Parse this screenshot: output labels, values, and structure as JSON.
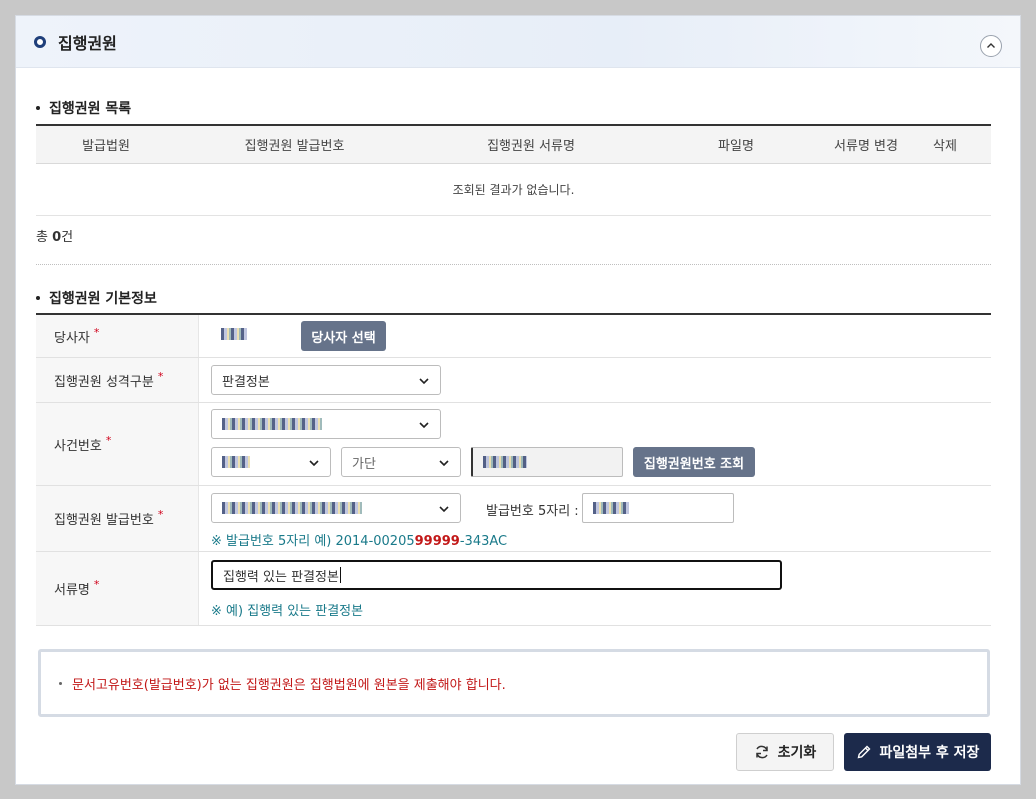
{
  "panel": {
    "title": "집행권원"
  },
  "list_section": {
    "title": "집행권원 목록",
    "columns": [
      "발급법원",
      "집행권원 발급번호",
      "집행권원 서류명",
      "파일명",
      "서류명 변경",
      "삭제"
    ],
    "empty_message": "조회된 결과가 없습니다.",
    "total_prefix": "총",
    "total_count": "0",
    "total_suffix": "건"
  },
  "form_section": {
    "title": "집행권원 기본정보",
    "party": {
      "label": "당사자",
      "select_button": "당사자 선택"
    },
    "nature": {
      "label": "집행권원 성격구분",
      "value": "판결정본"
    },
    "case_no": {
      "label": "사건번호",
      "case_type_value": "가단",
      "search_button": "집행권원번호 조회"
    },
    "issue_no": {
      "label": "집행권원 발급번호",
      "five_digit_label": "발급번호 5자리 :",
      "hint_prefix": "※ 발급번호 5자리 예) 2014-00205",
      "hint_highlight": "99999",
      "hint_suffix": "-343AC"
    },
    "doc_name": {
      "label": "서류명",
      "value": "집행력 있는 판결정본",
      "hint": "※ 예) 집행력 있는 판결정본"
    },
    "required_mark": "*"
  },
  "notice": {
    "text": "문서고유번호(발급번호)가 없는 집행권원은 집행법원에 원본을 제출해야 합니다."
  },
  "actions": {
    "reset_label": "초기화",
    "save_label": "파일첨부 후 저장"
  }
}
